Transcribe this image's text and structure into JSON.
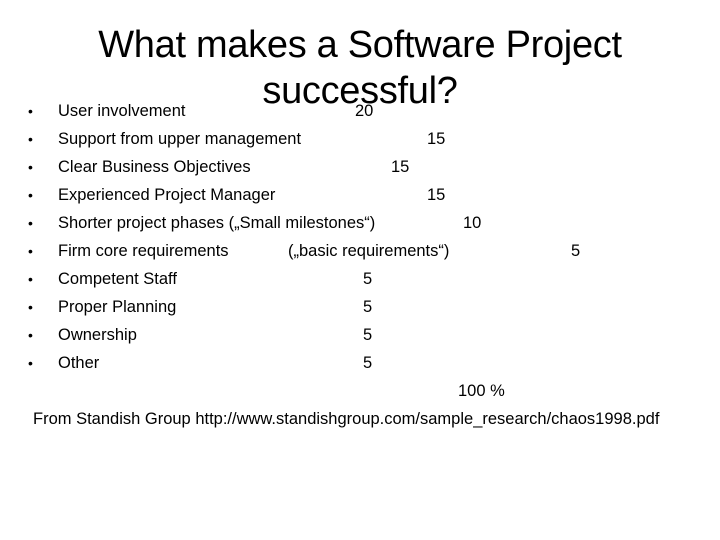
{
  "slide": {
    "title": "What makes a Software Project successful?",
    "bullet_glyph": "•",
    "items": [
      {
        "label": "User involvement",
        "extra": "",
        "value": "20"
      },
      {
        "label": "Support from upper management",
        "extra": "",
        "value": "15"
      },
      {
        "label": "Clear Business Objectives",
        "extra": "",
        "value": "15"
      },
      {
        "label": "Experienced Project Manager",
        "extra": "",
        "value": "15"
      },
      {
        "label": "Shorter project phases („Small milestones“)",
        "extra": "",
        "value": "10"
      },
      {
        "label": "Firm core requirements",
        "extra": "(„basic requirements“)",
        "value": "5"
      },
      {
        "label": "Competent Staff",
        "extra": "",
        "value": "5"
      },
      {
        "label": "Proper Planning",
        "extra": "",
        "value": "5"
      },
      {
        "label": "Ownership",
        "extra": "",
        "value": "5"
      },
      {
        "label": "Other",
        "extra": "",
        "value": "5"
      }
    ],
    "total": "100 %",
    "source": "From Standish Group http://www.standishgroup.com/sample_research/chaos1998.pdf"
  }
}
